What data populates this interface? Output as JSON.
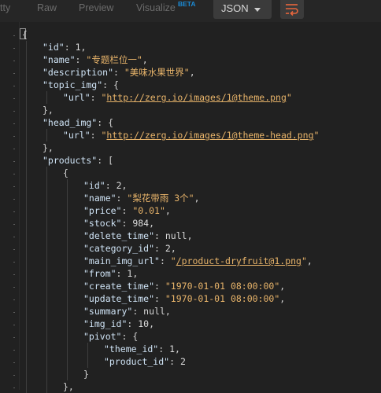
{
  "toolbar": {
    "tabs": [
      "tty",
      "Raw",
      "Preview",
      "Visualize"
    ],
    "beta": "BETA",
    "format": "JSON",
    "wrap_icon": "wrap-lines-icon"
  },
  "code": [
    [
      [
        "p",
        "{"
      ]
    ],
    [
      [
        "k",
        "\"id\""
      ],
      [
        "p",
        ": "
      ],
      [
        "n",
        "1"
      ],
      [
        "p",
        ","
      ]
    ],
    [
      [
        "k",
        "\"name\""
      ],
      [
        "p",
        ": "
      ],
      [
        "s",
        "\"专题栏位一\""
      ],
      [
        "p",
        ","
      ]
    ],
    [
      [
        "k",
        "\"description\""
      ],
      [
        "p",
        ": "
      ],
      [
        "s",
        "\"美味水果世界\""
      ],
      [
        "p",
        ","
      ]
    ],
    [
      [
        "k",
        "\"topic_img\""
      ],
      [
        "p",
        ": {"
      ]
    ],
    [
      [
        "k",
        "\"url\""
      ],
      [
        "p",
        ": "
      ],
      [
        "s",
        "\""
      ],
      [
        "u",
        "http://zerg.io/images/1@theme.png"
      ],
      [
        "s",
        "\""
      ]
    ],
    [
      [
        "p",
        "},"
      ]
    ],
    [
      [
        "k",
        "\"head_img\""
      ],
      [
        "p",
        ": {"
      ]
    ],
    [
      [
        "k",
        "\"url\""
      ],
      [
        "p",
        ": "
      ],
      [
        "s",
        "\""
      ],
      [
        "u",
        "http://zerg.io/images/1@theme-head.png"
      ],
      [
        "s",
        "\""
      ]
    ],
    [
      [
        "p",
        "},"
      ]
    ],
    [
      [
        "k",
        "\"products\""
      ],
      [
        "p",
        ": ["
      ]
    ],
    [
      [
        "p",
        "{"
      ]
    ],
    [
      [
        "k",
        "\"id\""
      ],
      [
        "p",
        ": "
      ],
      [
        "n",
        "2"
      ],
      [
        "p",
        ","
      ]
    ],
    [
      [
        "k",
        "\"name\""
      ],
      [
        "p",
        ": "
      ],
      [
        "s",
        "\"梨花带雨 3个\""
      ],
      [
        "p",
        ","
      ]
    ],
    [
      [
        "k",
        "\"price\""
      ],
      [
        "p",
        ": "
      ],
      [
        "s",
        "\"0.01\""
      ],
      [
        "p",
        ","
      ]
    ],
    [
      [
        "k",
        "\"stock\""
      ],
      [
        "p",
        ": "
      ],
      [
        "n",
        "984"
      ],
      [
        "p",
        ","
      ]
    ],
    [
      [
        "k",
        "\"delete_time\""
      ],
      [
        "p",
        ": "
      ],
      [
        "kw",
        "null"
      ],
      [
        "p",
        ","
      ]
    ],
    [
      [
        "k",
        "\"category_id\""
      ],
      [
        "p",
        ": "
      ],
      [
        "n",
        "2"
      ],
      [
        "p",
        ","
      ]
    ],
    [
      [
        "k",
        "\"main_img_url\""
      ],
      [
        "p",
        ": "
      ],
      [
        "s",
        "\""
      ],
      [
        "u",
        "/product-dryfruit@1.png"
      ],
      [
        "s",
        "\""
      ],
      [
        "p",
        ","
      ]
    ],
    [
      [
        "k",
        "\"from\""
      ],
      [
        "p",
        ": "
      ],
      [
        "n",
        "1"
      ],
      [
        "p",
        ","
      ]
    ],
    [
      [
        "k",
        "\"create_time\""
      ],
      [
        "p",
        ": "
      ],
      [
        "s",
        "\"1970-01-01 08:00:00\""
      ],
      [
        "p",
        ","
      ]
    ],
    [
      [
        "k",
        "\"update_time\""
      ],
      [
        "p",
        ": "
      ],
      [
        "s",
        "\"1970-01-01 08:00:00\""
      ],
      [
        "p",
        ","
      ]
    ],
    [
      [
        "k",
        "\"summary\""
      ],
      [
        "p",
        ": "
      ],
      [
        "kw",
        "null"
      ],
      [
        "p",
        ","
      ]
    ],
    [
      [
        "k",
        "\"img_id\""
      ],
      [
        "p",
        ": "
      ],
      [
        "n",
        "10"
      ],
      [
        "p",
        ","
      ]
    ],
    [
      [
        "k",
        "\"pivot\""
      ],
      [
        "p",
        ": {"
      ]
    ],
    [
      [
        "k",
        "\"theme_id\""
      ],
      [
        "p",
        ": "
      ],
      [
        "n",
        "1"
      ],
      [
        "p",
        ","
      ]
    ],
    [
      [
        "k",
        "\"product_id\""
      ],
      [
        "p",
        ": "
      ],
      [
        "n",
        "2"
      ]
    ],
    [
      [
        "p",
        "}"
      ]
    ],
    [
      [
        "p",
        "},"
      ]
    ]
  ]
}
